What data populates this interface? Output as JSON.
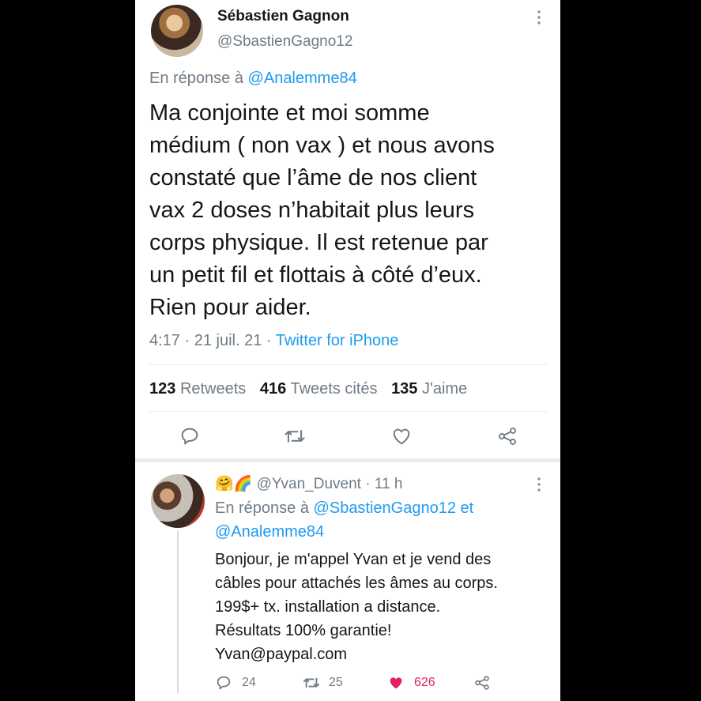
{
  "tweet": {
    "author_name": "Sébastien Gagnon",
    "author_handle": "@SbastienGagno12",
    "reply_prefix": "En réponse à",
    "reply_to": "@Analemme84",
    "body_lines": [
      "Ma conjointe et moi somme",
      "médium ( non vax )  et nous avons",
      "constaté que l’âme de nos client",
      "vax 2 doses  n’habitait plus leurs",
      "corps physique. Il est retenue par",
      "un petit fil et flottais à côté d’eux.",
      "Rien pour aider."
    ],
    "time": "4:17",
    "sep1": "·",
    "date": "21 juil. 21",
    "sep2": "·",
    "source": "Twitter for iPhone",
    "stats": {
      "retweets_count": "123",
      "retweets_label": "Retweets",
      "quotes_count": "416",
      "quotes_label": "Tweets cités",
      "likes_count": "135",
      "likes_label": "J'aime"
    },
    "icons": [
      "reply-icon",
      "retweet-icon",
      "like-icon",
      "share-icon"
    ]
  },
  "reply": {
    "emoji": "🤗🌈",
    "handle": "@Yvan_Duvent",
    "sep": "·",
    "age": "11 h",
    "reply_prefix": "En réponse à",
    "reply_to_1": "@SbastienGagno12",
    "reply_and": "et",
    "reply_to_2": "@Analemme84",
    "body_lines": [
      "Bonjour, je m'appel Yvan et je vend des",
      "câbles pour attachés les âmes au corps.",
      "199$+ tx. installation a distance.",
      "Résultats 100% garantie!",
      "Yvan@paypal.com"
    ],
    "reply_count": "24",
    "retweet_count": "25",
    "like_count": "626",
    "like_color": "#e0245e"
  }
}
